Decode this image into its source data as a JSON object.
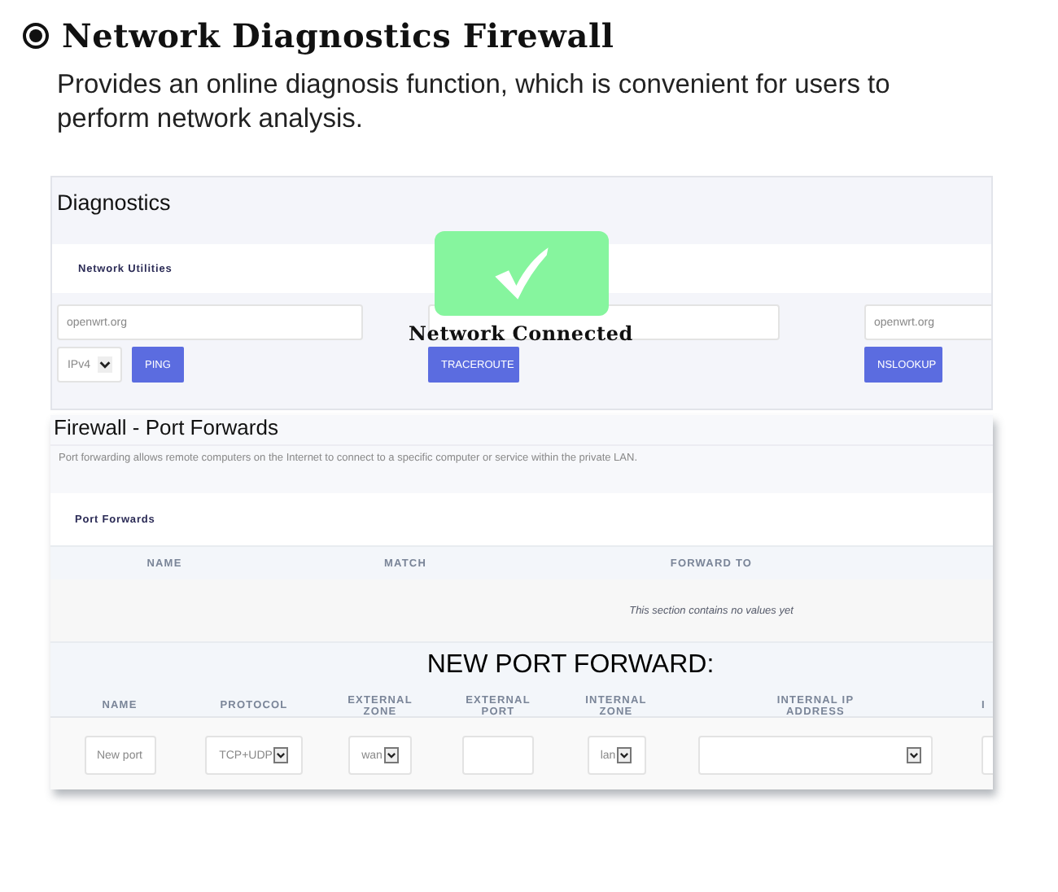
{
  "heading": {
    "title": "Network Diagnostics Firewall",
    "description": "Provides an online diagnosis function, which is convenient for users to perform network analysis."
  },
  "diagnostics": {
    "title": "Diagnostics",
    "section": "Network Utilities",
    "tools": [
      {
        "placeholder": "openwrt.org",
        "select": "IPv4",
        "button": "PING"
      },
      {
        "button": "TRACEROUTE"
      },
      {
        "placeholder": "openwrt.org",
        "button": "NSLOOKUP"
      }
    ],
    "status": {
      "text": "Network Connected"
    }
  },
  "port_forwards": {
    "title": "Firewall - Port Forwards",
    "description": "Port forwarding allows remote computers on the Internet to connect to a specific computer or service within the private LAN.",
    "section": "Port Forwards",
    "columns": [
      "NAME",
      "MATCH",
      "FORWARD TO"
    ],
    "empty_text": "This section contains no values yet",
    "new_title": "NEW PORT FORWARD:",
    "new_columns": [
      "NAME",
      "PROTOCOL",
      "EXTERNAL ZONE",
      "EXTERNAL PORT",
      "INTERNAL ZONE",
      "INTERNAL IP ADDRESS",
      "I"
    ],
    "new_fields": [
      {
        "kind": "text",
        "placeholder": "New port"
      },
      {
        "kind": "select",
        "value": "TCP+UDP"
      },
      {
        "kind": "select",
        "value": "wan"
      },
      {
        "kind": "text"
      },
      {
        "kind": "select",
        "value": "lan"
      },
      {
        "kind": "select"
      },
      {
        "kind": "text"
      }
    ]
  }
}
